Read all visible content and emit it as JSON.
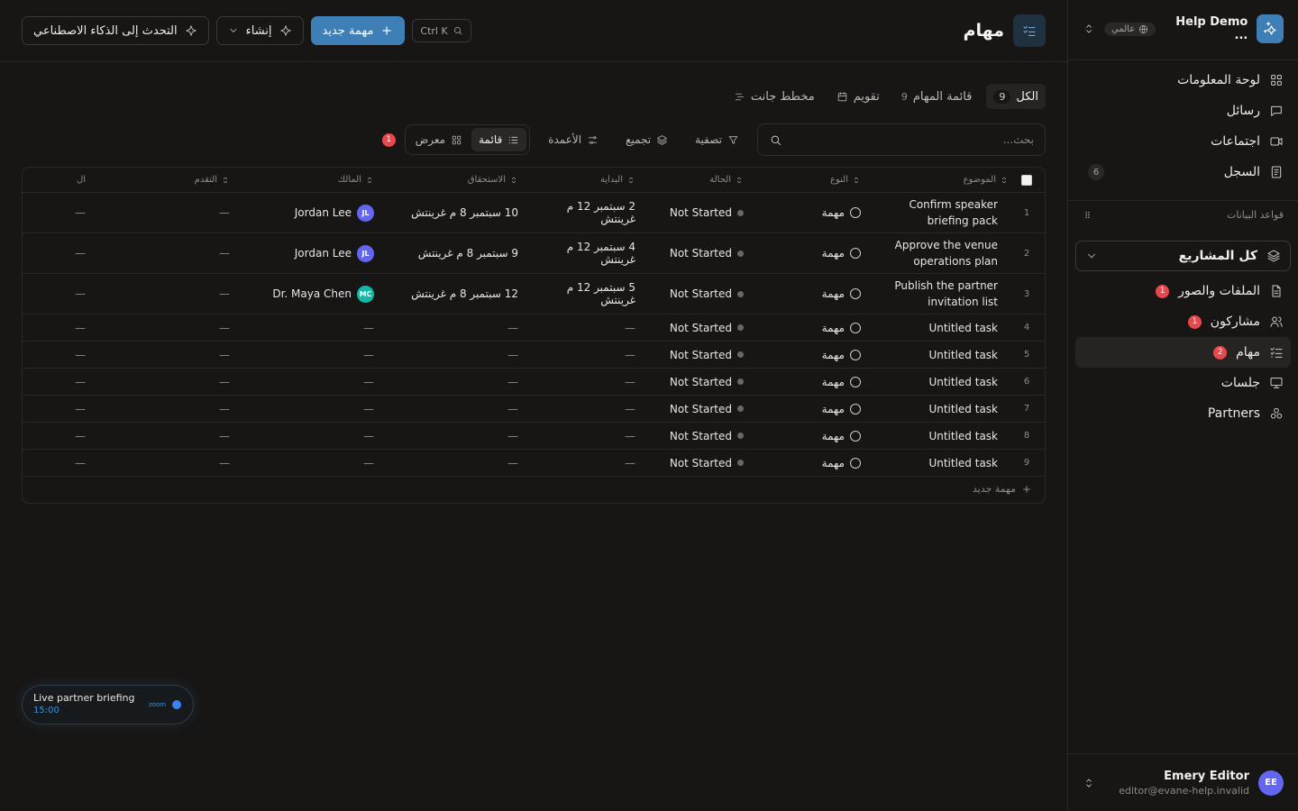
{
  "sidebar": {
    "workspace_name": "Help Demo ...",
    "workspace_badge": "عالمي",
    "nav": [
      {
        "label": "لوحة المعلومات",
        "icon": "dashboard-icon"
      },
      {
        "label": "رسائل",
        "icon": "message-icon"
      },
      {
        "label": "اجتماعات",
        "icon": "video-icon"
      },
      {
        "label": "السجل",
        "icon": "log-icon",
        "count": "6"
      }
    ],
    "databases_label": "قواعد البيانات",
    "project_select": "كل المشاريع",
    "databases": [
      {
        "label": "الملفات والصور",
        "badge": "1"
      },
      {
        "label": "مشاركون",
        "badge": "1"
      },
      {
        "label": "مهام",
        "badge": "2"
      },
      {
        "label": "جلسات"
      },
      {
        "label": "Partners"
      }
    ],
    "user": {
      "name": "Emery Editor",
      "email": "editor@evane-help.invalid",
      "initials": "EE"
    }
  },
  "header": {
    "title": "مهام",
    "shortcut": "Ctrl K",
    "new_task": "مهمة جديد",
    "create": "إنشاء",
    "ai_chat": "التحدث إلى الذكاء الاصطناعي"
  },
  "views": {
    "all": {
      "label": "الكل",
      "count": "9"
    },
    "task_list": {
      "label": "قائمة المهام",
      "count": "9"
    },
    "calendar": "تقويم",
    "gantt": "مخطط جانت"
  },
  "toolbar": {
    "search_placeholder": "بحث...",
    "filter": "تصفية",
    "group": "تجميع",
    "columns": "الأعمدة",
    "list": "قائمة",
    "gallery": "معرض",
    "badge": "1"
  },
  "table": {
    "headers": {
      "subject": "الموضوع",
      "type": "النوع",
      "status": "الحالة",
      "start": "البداية",
      "due": "الاستحقاق",
      "owner": "المالك",
      "progress": "التقدم",
      "extra": "ال"
    },
    "dash": "—",
    "rows": [
      {
        "num": "1",
        "subject": "Confirm speaker briefing pack",
        "type": "مهمة",
        "status": "Not Started",
        "start": "2 سبتمبر 12 م غرينتش",
        "due": "10 سبتمبر 8 م غرينتش",
        "owner": "Jordan Lee",
        "initials": "JL",
        "avatar_color": "#6366f1"
      },
      {
        "num": "2",
        "subject": "Approve the venue operations plan",
        "type": "مهمة",
        "status": "Not Started",
        "start": "4 سبتمبر 12 م غرينتش",
        "due": "9 سبتمبر 8 م غرينتش",
        "owner": "Jordan Lee",
        "initials": "JL",
        "avatar_color": "#6366f1"
      },
      {
        "num": "3",
        "subject": "Publish the partner invitation list",
        "type": "مهمة",
        "status": "Not Started",
        "start": "5 سبتمبر 12 م غرينتش",
        "due": "12 سبتمبر 8 م غرينتش",
        "owner": "Dr. Maya Chen",
        "initials": "MC",
        "avatar_color": "#14b8a6"
      },
      {
        "num": "4",
        "subject": "Untitled task",
        "type": "مهمة",
        "status": "Not Started"
      },
      {
        "num": "5",
        "subject": "Untitled task",
        "type": "مهمة",
        "status": "Not Started"
      },
      {
        "num": "6",
        "subject": "Untitled task",
        "type": "مهمة",
        "status": "Not Started"
      },
      {
        "num": "7",
        "subject": "Untitled task",
        "type": "مهمة",
        "status": "Not Started"
      },
      {
        "num": "8",
        "subject": "Untitled task",
        "type": "مهمة",
        "status": "Not Started"
      },
      {
        "num": "9",
        "subject": "Untitled task",
        "type": "مهمة",
        "status": "Not Started"
      }
    ],
    "add_label": "مهمة جديد"
  },
  "meeting": {
    "title": "Live partner briefing",
    "time": "15:00",
    "brand": "zoom"
  }
}
